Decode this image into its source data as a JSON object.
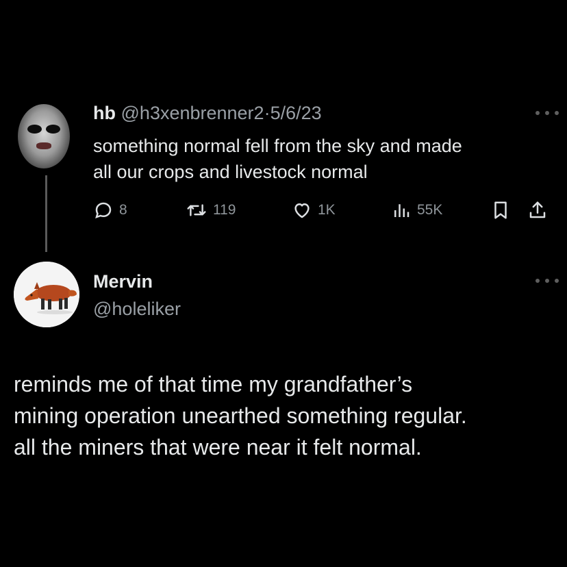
{
  "tweet": {
    "display_name": "hb",
    "handle": "@h3xenbrenner2",
    "separator": "·",
    "date": "5/6/23",
    "lines": [
      "something normal fell from the sky and made",
      "all our crops and livestock normal"
    ],
    "stats": {
      "replies": "8",
      "retweets": "119",
      "likes": "1K",
      "views": "55K"
    },
    "icons": {
      "reply": "reply-icon",
      "retweet": "retweet-icon",
      "like": "heart-icon",
      "views": "views-icon",
      "bookmark": "bookmark-icon",
      "share": "share-icon",
      "more": "more-icon"
    }
  },
  "reply": {
    "display_name": "Mervin",
    "handle": "@holeliker",
    "lines": [
      "reminds me of that time my grandfather’s",
      "mining operation unearthed something regular.",
      "all the miners that were near it felt normal."
    ]
  },
  "colors": {
    "background": "#000000",
    "text": "#e7e9ea",
    "muted": "#9aa0a6",
    "icon": "#8f959a"
  }
}
